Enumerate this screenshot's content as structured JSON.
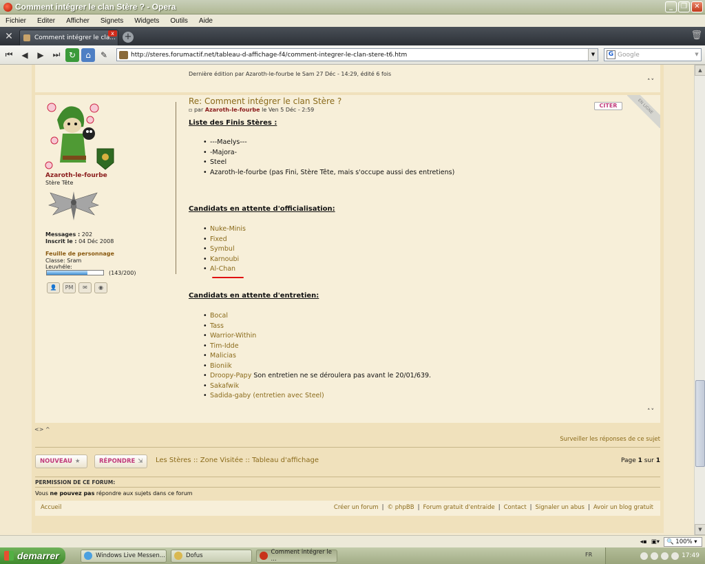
{
  "window": {
    "title": "Comment intégrer le clan Stère ? - Opera"
  },
  "menu": [
    "Fichier",
    "Editer",
    "Afficher",
    "Signets",
    "Widgets",
    "Outils",
    "Aide"
  ],
  "tab": {
    "label": "Comment intégrer le cla..."
  },
  "address": {
    "url": "http://steres.forumactif.net/tableau-d-affichage-f4/comment-integrer-le-clan-stere-t6.htm",
    "search_placeholder": "Google"
  },
  "edit_note": "Dernière édition par Azaroth-le-fourbe le Sam 27 Déc - 14:29, édité 6 fois",
  "updown": "˄˅",
  "post": {
    "title": "Re: Comment intégrer le clan Stère ?",
    "meta_prefix": "par",
    "meta_author": "Azaroth-le-fourbe",
    "meta_date": "le Ven 5 Déc - 2:59",
    "cite": "CITER",
    "online_ribbon": "EN LIGNE",
    "finis_heading": "Liste des Finis Stères :",
    "finis": [
      "---Maelys---",
      "-Majora-",
      "Steel",
      "Azaroth-le-fourbe (pas Fini, Stère Tête, mais s'occupe aussi des entretiens)"
    ],
    "offic_heading": "Candidats en attente d'officialisation:",
    "offic": [
      "Nuke-Minis",
      "Fixed",
      "Symbul",
      "Karnoubi",
      "Al-Chan"
    ],
    "entretien_heading": "Candidats en attente d'entretien:",
    "entretien": [
      "Bocal",
      "Tass",
      "Warrior-Within",
      "Tim-Idde",
      "Malicias",
      "Bioniik"
    ],
    "droopy_name": "Droopy-Papy",
    "droopy_note": "Son entretien ne se déroulera pas avant le 20/01/639.",
    "entretien_tail": [
      "Sakafwik",
      "Sadida-gaby (entretien avec Steel)"
    ]
  },
  "author": {
    "name": "Azaroth-le-fourbe",
    "rank": "Stère Tête",
    "messages_label": "Messages :",
    "messages_value": "202",
    "inscrit_label": "Inscrit le :",
    "inscrit_value": "04 Déc 2008",
    "sheet_title": "Feuille de personnage",
    "classe": "Classe: Sram",
    "leuvhele_label": "Leuvhéle:",
    "leuvhele_value": "(143/200)",
    "leuvhele_fraction": 0.715
  },
  "footer_actions": {
    "icons_row": "<> ^",
    "watch": "Surveiller les réponses de ce sujet",
    "new_btn": "NOUVEAU",
    "reply_btn": "RÉPONDRE",
    "crumb_1": "Les Stères",
    "crumb_sep": "::",
    "crumb_2": "Zone Visitée",
    "crumb_3": "Tableau d'affichage",
    "page_label": "Page",
    "page_num": "1",
    "page_sur": "sur",
    "page_total": "1"
  },
  "permissions": {
    "title": "PERMISSION DE CE FORUM:",
    "prefix": "Vous",
    "bold": "ne pouvez pas",
    "suffix": "répondre aux sujets dans ce forum"
  },
  "footer": {
    "home": "Accueil",
    "links": [
      "Créer un forum",
      "© phpBB",
      "Forum gratuit d'entraide",
      "Contact",
      "Signaler un abus",
      "Avoir un blog gratuit"
    ],
    "sep": "|"
  },
  "statusbar": {
    "zoom": "100%"
  },
  "taskbar": {
    "start": "demarrer",
    "tasks": [
      "Windows Live Messen...",
      "Dofus",
      "Comment intégrer le ..."
    ],
    "lang": "FR",
    "time": "17:49"
  }
}
